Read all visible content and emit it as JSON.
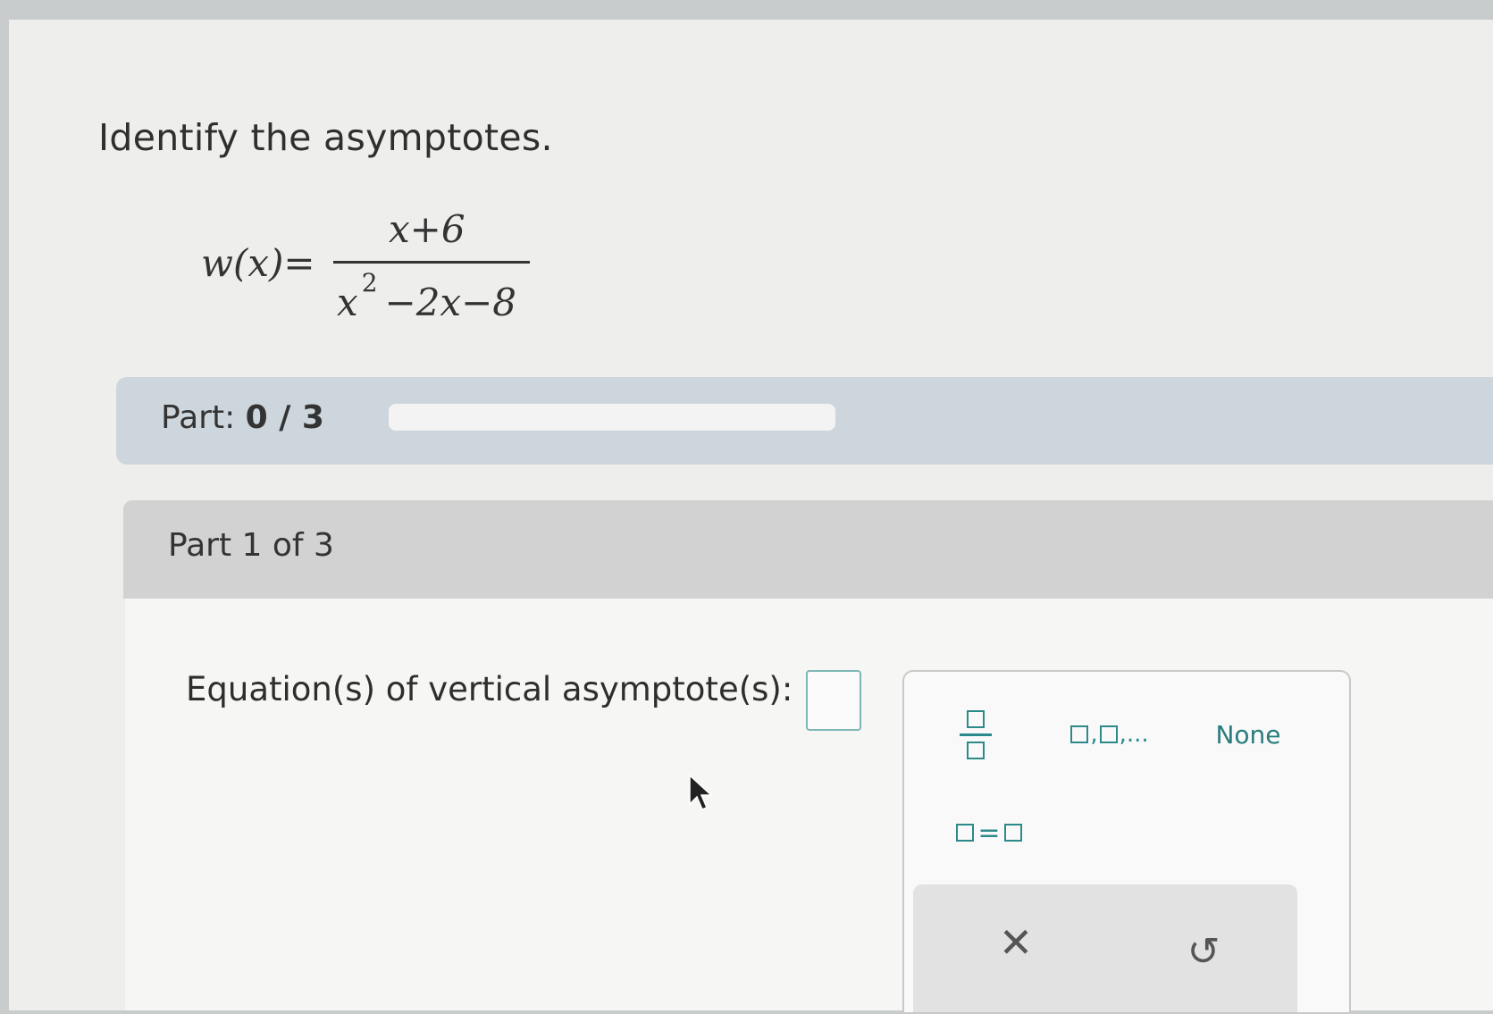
{
  "question": {
    "text": "Identify the asymptotes."
  },
  "formula": {
    "lhs": "w(x)=",
    "numerator": "x+6",
    "denominator_base": "x",
    "denominator_exponent": "2",
    "denominator_rest": "−2x−8"
  },
  "progress": {
    "label": "Part: ",
    "value_text": "0 / 3",
    "fraction_complete": 0,
    "fill_color": "#3a9c9b"
  },
  "part": {
    "header": "Part 1 of 3",
    "prompt": "Equation(s) of vertical asymptote(s):"
  },
  "keypad": {
    "list_ellipsis": ",...",
    "list_comma": ",",
    "none_label": "None",
    "eq_sign": "=",
    "clear_glyph": "✕",
    "undo_glyph": "↺",
    "icons": [
      "fraction-icon",
      "list-icon",
      "equation-icon",
      "clear-icon",
      "undo-icon"
    ]
  },
  "colors": {
    "accent": "#2d8a8a",
    "progress_track": "#f3f3f3",
    "part_bar": "#cdd6dd"
  }
}
